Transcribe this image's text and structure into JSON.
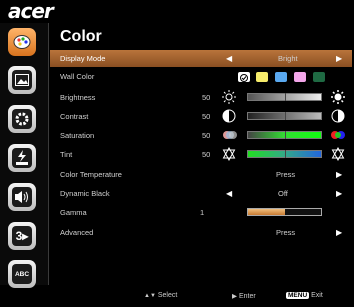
{
  "brand": {
    "logo_text": "acer"
  },
  "page": {
    "title": "Color"
  },
  "sidebar": {
    "tabs": [
      {
        "name": "color-tab-icon",
        "active": true
      },
      {
        "name": "picture-tab-icon",
        "active": false
      },
      {
        "name": "settings-tab-icon",
        "active": false
      },
      {
        "name": "power-tab-icon",
        "active": false
      },
      {
        "name": "audio-tab-icon",
        "active": false
      },
      {
        "name": "3d-tab-icon",
        "active": false,
        "text": "3"
      },
      {
        "name": "language-tab-icon",
        "active": false,
        "text": "ABC"
      }
    ]
  },
  "rows": {
    "display_mode": {
      "label": "Display Mode",
      "value": "Bright"
    },
    "wall_color": {
      "label": "Wall Color",
      "swatches": [
        "#ffffff",
        "#f6ec6b",
        "#5aa9f0",
        "#f3a6ea",
        "#1f6a43"
      ]
    },
    "brightness": {
      "label": "Brightness",
      "value": "50",
      "level": 0.5
    },
    "contrast": {
      "label": "Contrast",
      "value": "50",
      "level": 0.5
    },
    "saturation": {
      "label": "Saturation",
      "value": "50",
      "level": 0.5
    },
    "tint": {
      "label": "Tint",
      "value": "50",
      "level": 0.5
    },
    "color_temperature": {
      "label": "Color Temperature",
      "value": "Press"
    },
    "dynamic_black": {
      "label": "Dynamic Black",
      "value": "Off"
    },
    "gamma": {
      "label": "Gamma",
      "value": "1",
      "level": 0.5
    },
    "advanced": {
      "label": "Advanced",
      "value": "Press"
    }
  },
  "footer": {
    "select_label": "Select",
    "enter_label": "Enter",
    "menu_key": "MENU",
    "exit_label": "Exit"
  },
  "colors": {
    "highlight": "#a8622c",
    "accent": "#e08a3a"
  }
}
